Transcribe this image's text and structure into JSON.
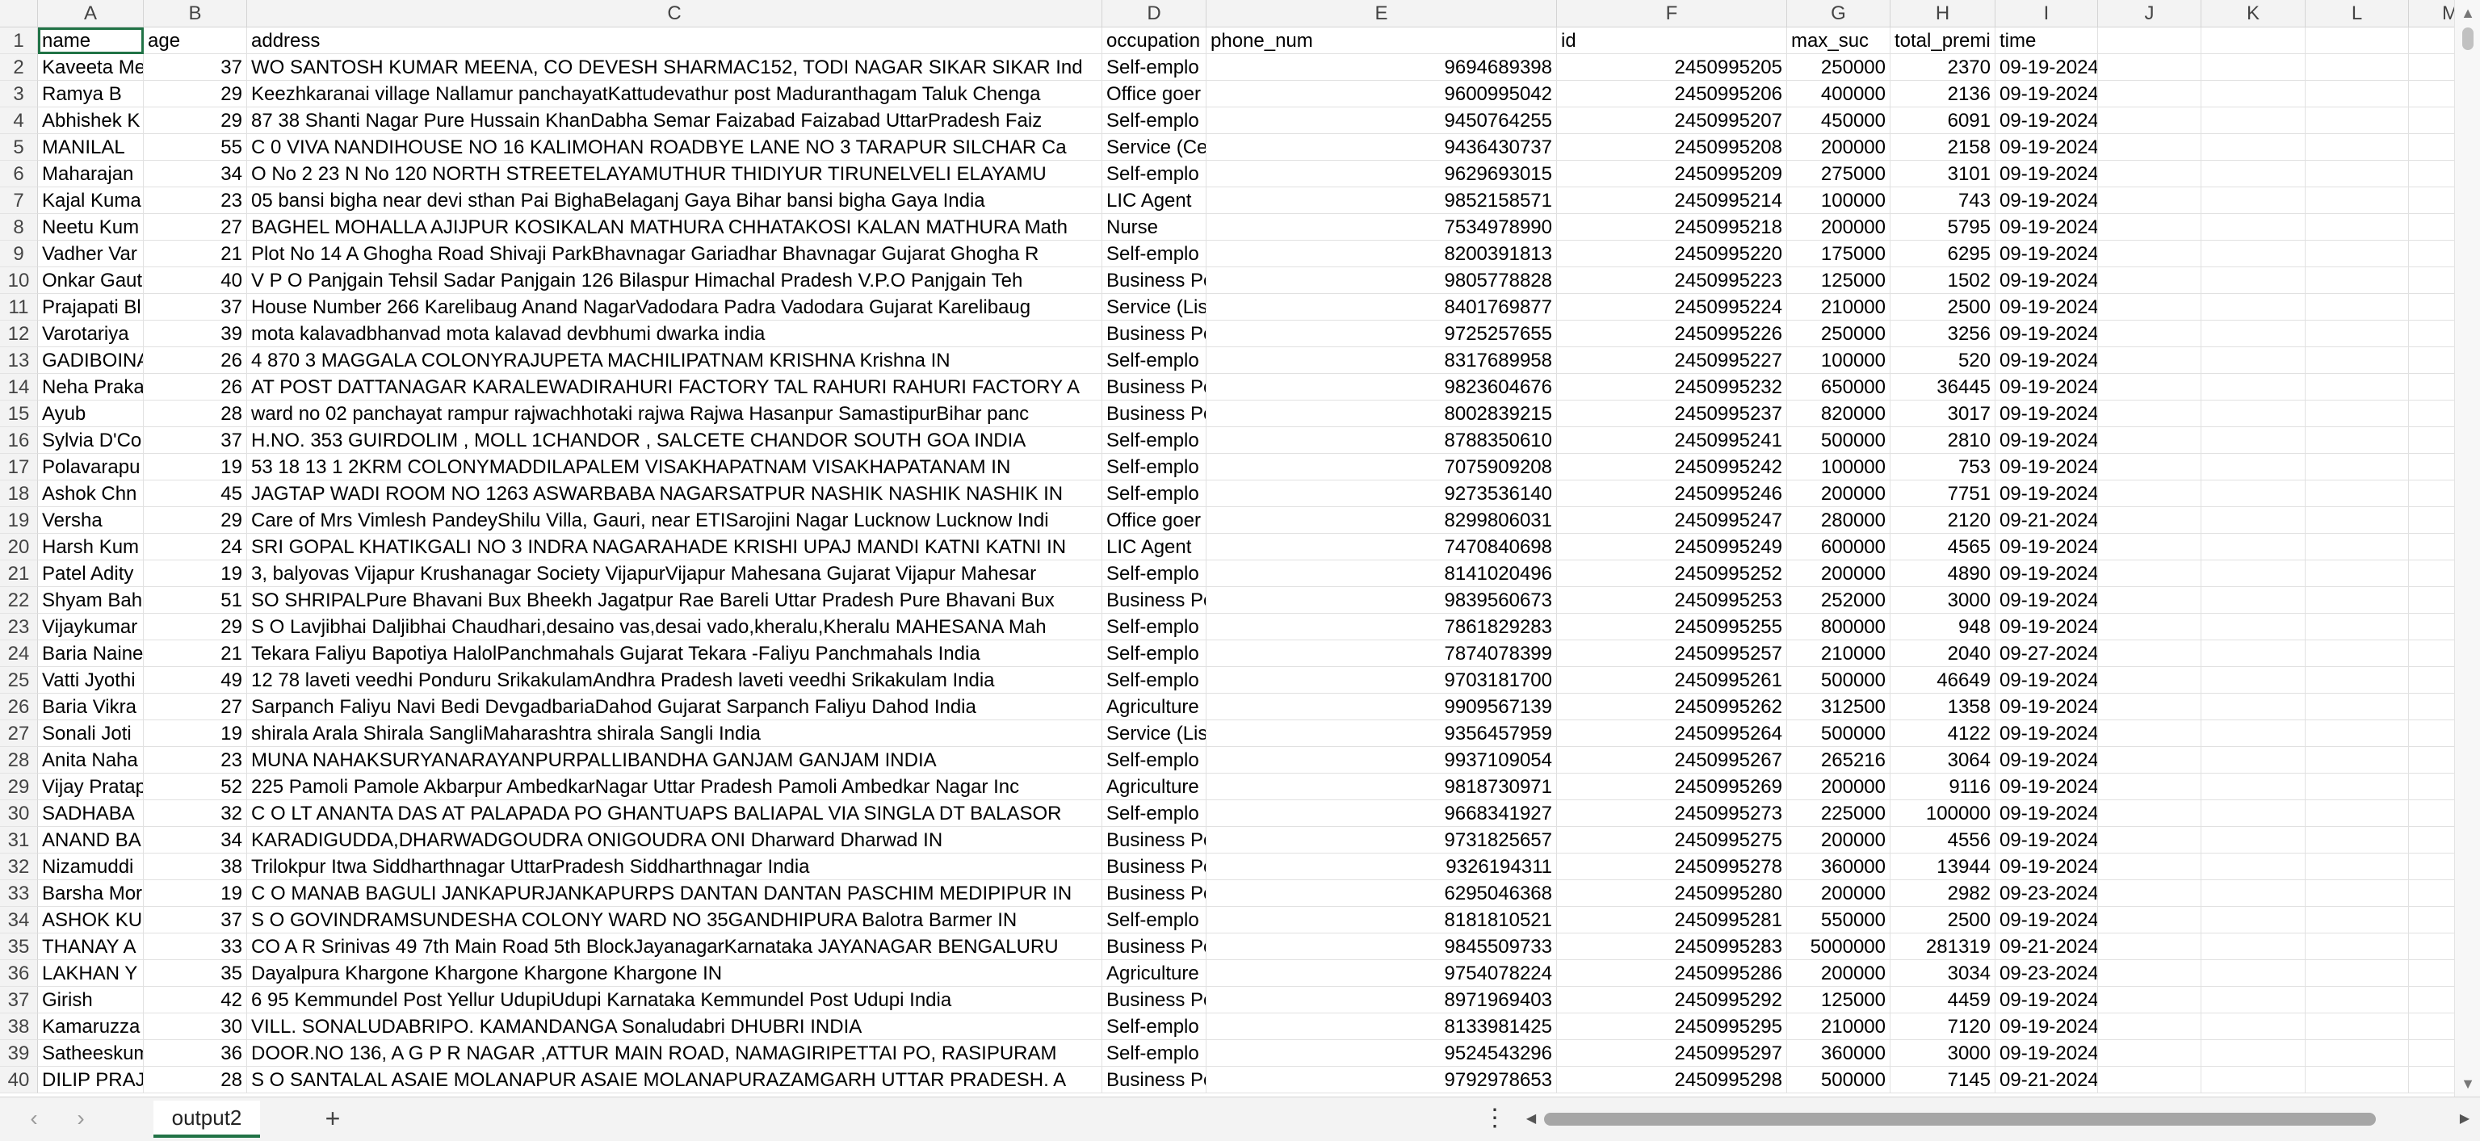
{
  "sheet": {
    "selected_cell": "A1",
    "column_letters": [
      "A",
      "B",
      "C",
      "D",
      "E",
      "F",
      "G",
      "H",
      "I",
      "J",
      "K",
      "L",
      "M"
    ],
    "rows": [
      {
        "n": "1",
        "cells": [
          "name",
          "age",
          "address",
          "occupation",
          "phone_num",
          "id",
          "",
          "max_suc",
          "total_premi",
          "time"
        ]
      },
      {
        "n": "2",
        "cells": [
          "Kaveeta Me",
          "37",
          "WO SANTOSH KUMAR MEENA, CO DEVESH SHARMAC152, TODI NAGAR SIKAR SIKAR Ind",
          "Self-emplo",
          "",
          "9694689398",
          "2450995205",
          "250000",
          "2370",
          "09-19-2024"
        ]
      },
      {
        "n": "3",
        "cells": [
          "Ramya B",
          "29",
          "Keezhkaranai village Nallamur panchayatKattudevathur post Maduranthagam Taluk Chenga",
          "Office goer",
          "",
          "9600995042",
          "2450995206",
          "400000",
          "2136",
          "09-19-2024"
        ]
      },
      {
        "n": "4",
        "cells": [
          "Abhishek K",
          "29",
          "87 38  Shanti Nagar  Pure Hussain KhanDabha Semar Faizabad Faizabad UttarPradesh  Faiz",
          "Self-emplo",
          "",
          "9450764255",
          "2450995207",
          "450000",
          "6091",
          "09-19-2024"
        ]
      },
      {
        "n": "5",
        "cells": [
          "MANILAL",
          "55",
          "C 0 VIVA NANDIHOUSE NO 16 KALIMOHAN ROADBYE LANE NO 3 TARAPUR SILCHAR Ca",
          "Service (Ce",
          "",
          "9436430737",
          "2450995208",
          "200000",
          "2158",
          "09-19-2024"
        ]
      },
      {
        "n": "6",
        "cells": [
          "Maharajan",
          "34",
          "O No 2 23 N No 120  NORTH STREETELAYAMUTHUR    THIDIYUR TIRUNELVELI ELAYAMU",
          "Self-emplo",
          "",
          "9629693015",
          "2450995209",
          "275000",
          "3101",
          "09-19-2024"
        ]
      },
      {
        "n": "7",
        "cells": [
          "Kajal Kuma",
          "23",
          "05 bansi bigha near devi sthan Pai BighaBelaganj Gaya Bihar  bansi bigha Gaya India",
          "LIC Agent",
          "",
          "9852158571",
          "2450995214",
          "100000",
          "743",
          "09-19-2024"
        ]
      },
      {
        "n": "8",
        "cells": [
          "Neetu Kum",
          "27",
          "BAGHEL MOHALLA AJIJPUR KOSIKALAN MATHURA CHHATAKOSI KALAN MATHURA Math",
          "Nurse",
          "",
          "7534978990",
          "2450995218",
          "200000",
          "5795",
          "09-19-2024"
        ]
      },
      {
        "n": "9",
        "cells": [
          "Vadher Var",
          "21",
          "Plot No 14 A Ghogha Road Shivaji ParkBhavnagar Gariadhar Bhavnagar Gujarat  Ghogha R",
          "Self-emplo",
          "",
          "8200391813",
          "2450995220",
          "175000",
          "6295",
          "09-19-2024"
        ]
      },
      {
        "n": "10",
        "cells": [
          "Onkar Gaut",
          "40",
          "V P O Panjgain Tehsil Sadar  Panjgain  126   Bilaspur Himachal Pradesh  V.P.O Panjgain Teh",
          "Business Pe",
          "",
          "9805778828",
          "2450995223",
          "125000",
          "1502",
          "09-19-2024"
        ]
      },
      {
        "n": "11",
        "cells": [
          "Prajapati Bl",
          "37",
          "House Number 266 Karelibaug Anand NagarVadodara Padra Vadodara Gujarat  Karelibaug",
          "Service (Lis",
          "",
          "8401769877",
          "2450995224",
          "210000",
          "2500",
          "09-19-2024"
        ]
      },
      {
        "n": "12",
        "cells": [
          "Varotariya",
          "39",
          "mota kalavadbhanvad mota kalavad devbhumi dwarka india",
          "Business Pe",
          "",
          "9725257655",
          "2450995226",
          "250000",
          "3256",
          "09-19-2024"
        ]
      },
      {
        "n": "13",
        "cells": [
          "GADIBOINA",
          "26",
          "4 870 3 MAGGALA COLONYRAJUPETA MACHILIPATNAM KRISHNA Krishna IN",
          "Self-emplo",
          "",
          "8317689958",
          "2450995227",
          "100000",
          "520",
          "09-19-2024"
        ]
      },
      {
        "n": "14",
        "cells": [
          "Neha Praka",
          "26",
          "AT POST DATTANAGAR KARALEWADIRAHURI FACTORY TAL RAHURI RAHURI FACTORY  A",
          "Business Pe",
          "",
          "9823604676",
          "2450995232",
          "650000",
          "36445",
          "09-19-2024"
        ]
      },
      {
        "n": "15",
        "cells": [
          "Ayub",
          "28",
          "ward no  02 panchayat rampur rajwachhotaki rajwa Rajwa Hasanpur SamastipurBihar panc",
          "Business Pe",
          "",
          "8002839215",
          "2450995237",
          "820000",
          "3017",
          "09-19-2024"
        ]
      },
      {
        "n": "16",
        "cells": [
          "Sylvia D'Co",
          "37",
          "H.NO. 353 GUIRDOLIM , MOLL 1CHANDOR , SALCETE  CHANDOR SOUTH GOA INDIA",
          "Self-emplo",
          "",
          "8788350610",
          "2450995241",
          "500000",
          "2810",
          "09-19-2024"
        ]
      },
      {
        "n": "17",
        "cells": [
          "Polavarapu",
          "19",
          "53 18 13 1 2KRM COLONYMADDILAPALEM VISAKHAPATNAM VISAKHAPATANAM IN",
          "Self-emplo",
          "",
          "7075909208",
          "2450995242",
          "100000",
          "753",
          "09-19-2024"
        ]
      },
      {
        "n": "18",
        "cells": [
          "Ashok Chn",
          "45",
          "JAGTAP WADI ROOM NO 1263 ASWARBABA NAGARSATPUR NASHIK NASHIK NASHIK IN",
          "Self-emplo",
          "",
          "9273536140",
          "2450995246",
          "200000",
          "7751",
          "09-19-2024"
        ]
      },
      {
        "n": "19",
        "cells": [
          "Versha",
          "29",
          "Care of Mrs Vimlesh PandeyShilu Villa, Gauri, near ETISarojini Nagar Lucknow Lucknow Indi",
          "Office goer",
          "",
          "8299806031",
          "2450995247",
          "280000",
          "2120",
          "09-21-2024"
        ]
      },
      {
        "n": "20",
        "cells": [
          "Harsh Kum",
          "24",
          "SRI GOPAL KHATIKGALI NO 3 INDRA NAGARAHADE KRISHI UPAJ MANDI KATNI KATNI IN",
          "LIC Agent",
          "",
          "7470840698",
          "2450995249",
          "600000",
          "4565",
          "09-19-2024"
        ]
      },
      {
        "n": "21",
        "cells": [
          "Patel Adity",
          "19",
          "3, balyovas Vijapur Krushanagar Society VijapurVijapur Mahesana Gujarat  Vijapur Mahesar",
          "Self-emplo",
          "",
          "8141020496",
          "2450995252",
          "200000",
          "4890",
          "09-19-2024"
        ]
      },
      {
        "n": "22",
        "cells": [
          "Shyam Bah",
          "51",
          "SO SHRIPALPure Bhavani Bux Bheekh  Jagatpur  Rae Bareli Uttar Pradesh Pure Bhavani Bux",
          "Business Pe",
          "",
          "9839560673",
          "2450995253",
          "252000",
          "3000",
          "09-19-2024"
        ]
      },
      {
        "n": "23",
        "cells": [
          "Vijaykumar",
          "29",
          "S O  Lavjibhai Daljibhai Chaudhari,desaino vas,desai vado,kheralu,Kheralu MAHESANA Mah",
          "Self-emplo",
          "",
          "7861829283",
          "2450995255",
          "800000",
          "948",
          "09-19-2024"
        ]
      },
      {
        "n": "24",
        "cells": [
          "Baria Naine",
          "21",
          "Tekara  Faliyu  Bapotiya HalolPanchmahals Gujarat  Tekara -Faliyu Panchmahals India",
          "Self-emplo",
          "",
          "7874078399",
          "2450995257",
          "210000",
          "2040",
          "09-27-2024"
        ]
      },
      {
        "n": "25",
        "cells": [
          "Vatti Jyothi",
          "49",
          "12 78 laveti veedhi  Ponduru  SrikakulamAndhra Pradesh  laveti veedhi Srikakulam India",
          "Self-emplo",
          "",
          "9703181700",
          "2450995261",
          "500000",
          "46649",
          "09-19-2024"
        ]
      },
      {
        "n": "26",
        "cells": [
          "Baria Vikra",
          "27",
          "Sarpanch Faliyu  Navi Bedi DevgadbariaDahod Gujarat  Sarpanch Faliyu Dahod India",
          "Agriculture",
          "",
          "9909567139",
          "2450995262",
          "312500",
          "1358",
          "09-19-2024"
        ]
      },
      {
        "n": "27",
        "cells": [
          "Sonali Joti",
          "19",
          "shirala  Arala Shirala SangliMaharashtra  shirala Sangli India",
          "Service (Lis",
          "",
          "9356457959",
          "2450995264",
          "500000",
          "4122",
          "09-19-2024"
        ]
      },
      {
        "n": "28",
        "cells": [
          "Anita Naha",
          "23",
          "MUNA NAHAKSURYANARAYANPURPALLIBANDHA GANJAM GANJAM INDIA",
          "Self-emplo",
          "",
          "9937109054",
          "2450995267",
          "265216",
          "3064",
          "09-19-2024"
        ]
      },
      {
        "n": "29",
        "cells": [
          "Vijay Pratap",
          "52",
          "225 Pamoli  Pamole Akbarpur AmbedkarNagar Uttar Pradesh  Pamoli Ambedkar Nagar Inc",
          "Agriculture",
          "",
          "9818730971",
          "2450995269",
          "200000",
          "9116",
          "09-19-2024"
        ]
      },
      {
        "n": "30",
        "cells": [
          "SADHABA",
          "32",
          "C O LT ANANTA DAS AT PALAPADA PO GHANTUAPS BALIAPAL VIA SINGLA DT BALASOR",
          "Self-emplo",
          "",
          "9668341927",
          "2450995273",
          "225000",
          "100000",
          "09-19-2024"
        ]
      },
      {
        "n": "31",
        "cells": [
          "ANAND BA",
          "34",
          "KARADIGUDDA,DHARWADGOUDRA ONIGOUDRA ONI Dharward Dharwad IN",
          "Business Pe",
          "",
          "9731825657",
          "2450995275",
          "200000",
          "4556",
          "09-19-2024"
        ]
      },
      {
        "n": "32",
        "cells": [
          "Nizamuddi",
          "38",
          "Trilokpur Itwa Siddharthnagar UttarPradesh   Siddharthnagar India",
          "Business Pe",
          "",
          "9326194311",
          "2450995278",
          "360000",
          "13944",
          "09-19-2024"
        ]
      },
      {
        "n": "33",
        "cells": [
          "Barsha Mor",
          "19",
          "C O MANAB BAGULI  JANKAPURJANKAPURPS DANTAN DANTAN PASCHIM MEDIPIPUR IN",
          "Business Pe",
          "",
          "6295046368",
          "2450995280",
          "200000",
          "2982",
          "09-23-2024"
        ]
      },
      {
        "n": "34",
        "cells": [
          "ASHOK KU",
          "37",
          "S O GOVINDRAMSUNDESHA COLONY WARD NO 35GANDHIPURA Balotra Barmer IN",
          "Self-emplo",
          "",
          "8181810521",
          "2450995281",
          "550000",
          "2500",
          "09-19-2024"
        ]
      },
      {
        "n": "35",
        "cells": [
          "THANAY A",
          "33",
          "CO A R Srinivas 49 7th Main Road 5th BlockJayanagarKarnataka JAYANAGAR BENGALURU",
          "Business Pe",
          "",
          "9845509733",
          "2450995283",
          "5000000",
          "281319",
          "09-21-2024"
        ]
      },
      {
        "n": "36",
        "cells": [
          "LAKHAN  Y",
          "35",
          "Dayalpura Khargone Khargone Khargone Khargone IN",
          "Agriculture",
          "",
          "9754078224",
          "2450995286",
          "200000",
          "3034",
          "09-23-2024"
        ]
      },
      {
        "n": "37",
        "cells": [
          "Girish",
          "42",
          "  6 95 Kemmundel Post  Yellur UdupiUdupi Karnataka  Kemmundel Post Udupi India",
          "Business Pe",
          "",
          "8971969403",
          "2450995292",
          "125000",
          "4459",
          "09-19-2024"
        ]
      },
      {
        "n": "38",
        "cells": [
          "Kamaruzza",
          "30",
          "VILL. SONALUDABRIPO. KAMANDANGA Sonaludabri DHUBRI INDIA",
          "Self-emplo",
          "",
          "8133981425",
          "2450995295",
          "210000",
          "7120",
          "09-19-2024"
        ]
      },
      {
        "n": "39",
        "cells": [
          "Satheeskum",
          "36",
          "DOOR.NO 136, A G P R NAGAR ,ATTUR MAIN ROAD,  NAMAGIRIPETTAI PO, RASIPURAM",
          "Self-emplo",
          "",
          "9524543296",
          "2450995297",
          "360000",
          "3000",
          "09-19-2024"
        ]
      },
      {
        "n": "40",
        "cells": [
          "DILIP  PRAJ",
          "28",
          "S O SANTALAL ASAIE MOLANAPUR ASAIE MOLANAPURAZAMGARH UTTAR PRADESH. A",
          "Business Pe",
          "",
          "9792978653",
          "2450995298",
          "500000",
          "7145",
          "09-21-2024"
        ]
      }
    ]
  },
  "tabs": {
    "active": "output2",
    "add_label": "+",
    "more_label": "⋮"
  },
  "colors": {
    "accent": "#217346",
    "header_bg": "#f3f3f3",
    "grid": "#e1e1e1"
  }
}
